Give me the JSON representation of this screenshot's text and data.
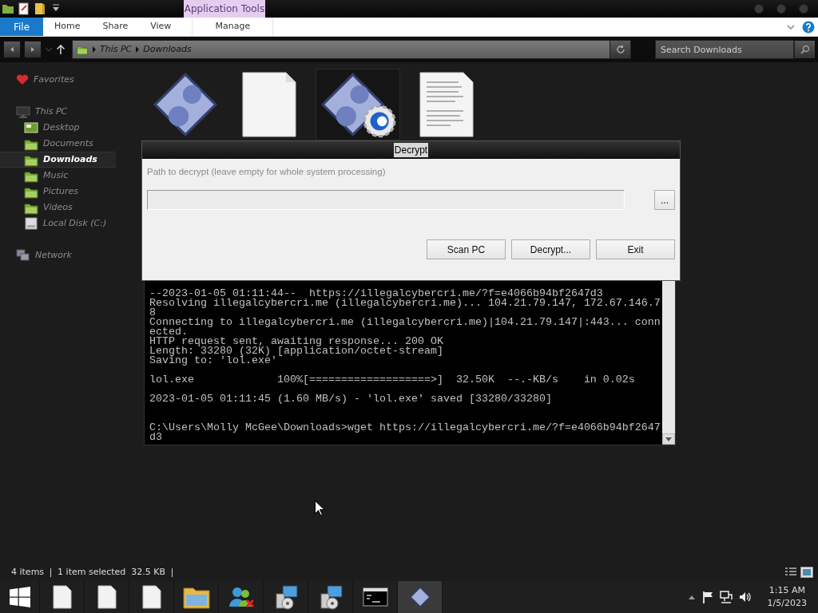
{
  "explorer": {
    "contextual_tab_group": "Application Tools",
    "ribbon_tabs": [
      {
        "label": "File",
        "kind": "file",
        "selected": false
      },
      {
        "label": "Home",
        "kind": "tab",
        "selected": false
      },
      {
        "label": "Share",
        "kind": "tab",
        "selected": false
      },
      {
        "label": "View",
        "kind": "tab",
        "selected": false
      },
      {
        "label": "Manage",
        "kind": "contextual",
        "selected": false
      }
    ],
    "address": {
      "path": [
        "This PC",
        "Downloads"
      ]
    },
    "search": {
      "placeholder": "Search Downloads"
    },
    "sidebar": [
      {
        "label": "Favorites",
        "kind": "favorites",
        "selected": false
      },
      {
        "label": "This PC",
        "kind": "pc",
        "selected": false,
        "children": [
          {
            "label": "Desktop",
            "kind": "desktop",
            "selected": false
          },
          {
            "label": "Documents",
            "kind": "folder",
            "selected": false
          },
          {
            "label": "Downloads",
            "kind": "folder",
            "selected": true
          },
          {
            "label": "Music",
            "kind": "folder",
            "selected": false
          },
          {
            "label": "Pictures",
            "kind": "folder",
            "selected": false
          },
          {
            "label": "Videos",
            "kind": "folder",
            "selected": false
          },
          {
            "label": "Local Disk (C:)",
            "kind": "disk",
            "selected": false
          }
        ]
      },
      {
        "label": "Network",
        "kind": "network",
        "selected": false
      }
    ],
    "files": [
      {
        "kind": "app",
        "selected": false
      },
      {
        "kind": "blank",
        "selected": false
      },
      {
        "kind": "app-gear",
        "selected": true
      },
      {
        "kind": "text",
        "selected": false
      }
    ],
    "status_bar": {
      "item_count": "4 items",
      "selection": "1 item selected  32.5 KB"
    }
  },
  "decrypt_dialog": {
    "title": "Decrypt",
    "label": "Path to decrypt (leave empty for whole system processing)",
    "browse_button": "...",
    "buttons": [
      "Scan PC",
      "Decrypt...",
      "Exit"
    ]
  },
  "console": {
    "blocks": [
      {
        "kind": "output",
        "lines": [
          "--2023-01-05 01:11:44--  https://illegalcybercri.me/?f=e4066b94bf2647d3",
          "Resolving illegalcybercri.me (illegalcybercri.me)... 104.21.79.147, 172.67.146.7",
          "8",
          "Connecting to illegalcybercri.me (illegalcybercri.me)|104.21.79.147|:443... conn",
          "ected.",
          "HTTP request sent, awaiting response... 200 OK",
          "Length: 33280 (32K) [application/octet-stream]",
          "Saving to: 'lol.exe'"
        ]
      },
      {
        "kind": "output",
        "lines": [
          "lol.exe             100%[===================>]  32.50K  --.-KB/s    in 0.02s"
        ]
      },
      {
        "kind": "output",
        "lines": [
          "2023-01-05 01:11:45 (1.60 MB/s) - 'lol.exe' saved [33280/33280]"
        ]
      },
      {
        "kind": "prompt",
        "lines": [
          "C:\\Users\\Molly McGee\\Downloads>wget https://illegalcybercri.me/?f=e4066b94bf2647",
          "d3"
        ]
      }
    ]
  },
  "taskbar": {
    "apps": [
      {
        "kind": "file",
        "selected": false
      },
      {
        "kind": "file",
        "selected": false
      },
      {
        "kind": "file",
        "selected": false
      },
      {
        "kind": "folder",
        "selected": false
      },
      {
        "kind": "people",
        "selected": false
      },
      {
        "kind": "installer",
        "selected": false
      },
      {
        "kind": "installer",
        "selected": false
      },
      {
        "kind": "console",
        "selected": false
      },
      {
        "kind": "app",
        "selected": true
      }
    ],
    "clock": {
      "time": "1:15 AM",
      "date": "1/5/2023"
    }
  }
}
